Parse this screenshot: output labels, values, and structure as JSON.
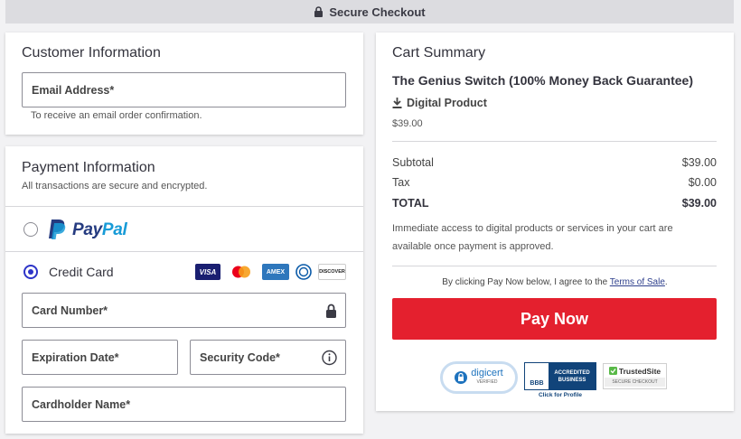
{
  "header": {
    "title": "Secure Checkout",
    "icon": "lock-icon"
  },
  "customer": {
    "title": "Customer Information",
    "email_label": "Email Address*",
    "email_hint": "To receive an email order confirmation."
  },
  "payment": {
    "title": "Payment Information",
    "subtitle": "All transactions are secure and encrypted.",
    "paypal": {
      "word1": "Pay",
      "word2": "Pal",
      "selected": false
    },
    "credit_card": {
      "label": "Credit Card",
      "selected": true,
      "logos": [
        "VISA",
        "mastercard",
        "AMEX",
        "diners",
        "DISCOVER"
      ]
    },
    "fields": {
      "card_number": "Card Number*",
      "expiration": "Expiration Date*",
      "security_code": "Security Code*",
      "cardholder": "Cardholder Name*"
    }
  },
  "cart": {
    "title": "Cart Summary",
    "product_name": "The Genius Switch (100% Money Back Guarantee)",
    "product_type": "Digital Product",
    "product_price": "$39.00",
    "subtotal_label": "Subtotal",
    "subtotal_value": "$39.00",
    "tax_label": "Tax",
    "tax_value": "$0.00",
    "total_label": "TOTAL",
    "total_value": "$39.00",
    "note": "Immediate access to digital products or services in your cart are available once payment is approved.",
    "agree_prefix": "By clicking Pay Now below, I agree to the ",
    "agree_link": "Terms of Sale",
    "agree_suffix": ".",
    "pay_button": "Pay Now"
  },
  "badges": {
    "digicert": {
      "name": "digicert",
      "sub": "VERIFIED"
    },
    "bbb": {
      "line1": "ACCREDITED",
      "line2": "BUSINESS",
      "mark": "BBB",
      "caption": "Click for Profile"
    },
    "trustedsite": {
      "name": "TrustedSite",
      "sub": "SECURE CHECKOUT"
    }
  },
  "colors": {
    "accent": "#2d34c8",
    "pay_button": "#e4202e",
    "paypal_dark": "#253b80",
    "paypal_light": "#179bd7"
  }
}
